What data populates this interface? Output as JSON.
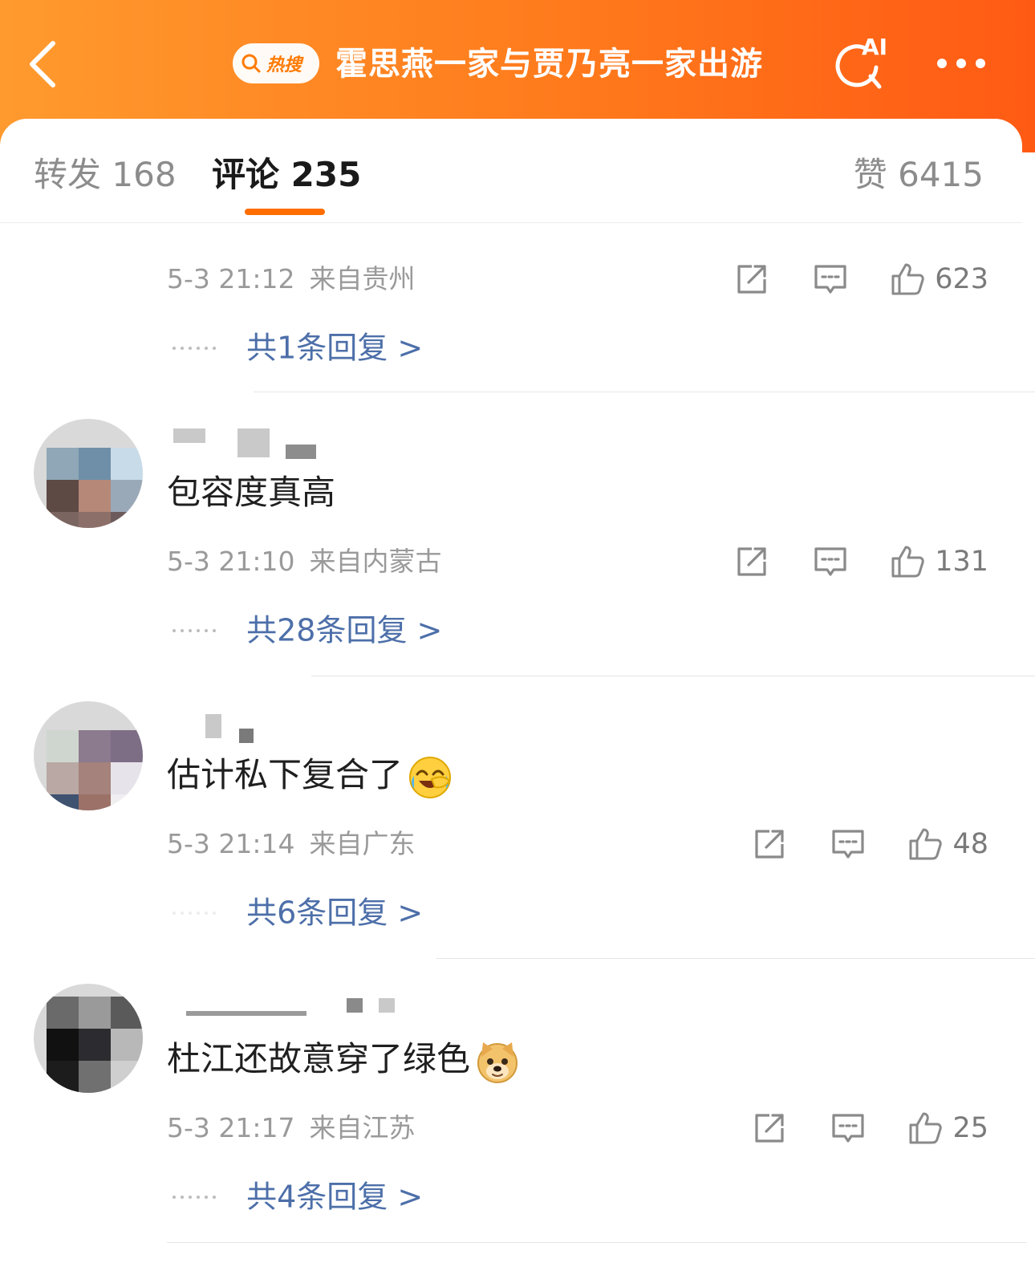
{
  "header": {
    "hot_badge": "热搜",
    "title": "霍思燕一家与贾乃亮一家出游",
    "ai_label": "AI"
  },
  "tabs": {
    "repost": {
      "label": "转发",
      "count": "168"
    },
    "comments": {
      "label": "评论",
      "count": "235"
    },
    "likes": {
      "label": "赞",
      "count": "6415"
    }
  },
  "comments": [
    {
      "text": "",
      "time": "5-3 21:12",
      "location": "来自贵州",
      "likes": "623",
      "replies": "共1条回复 >"
    },
    {
      "text": "包容度真高",
      "time": "5-3 21:10",
      "location": "来自内蒙古",
      "likes": "131",
      "replies": "共28条回复 >"
    },
    {
      "text": "估计私下复合了",
      "emoji": "laugh-cry-emoji",
      "time": "5-3 21:14",
      "location": "来自广东",
      "likes": "48",
      "replies": "共6条回复 >"
    },
    {
      "text": "杜江还故意穿了绿色",
      "emoji": "doge-emoji",
      "time": "5-3 21:17",
      "location": "来自江苏",
      "likes": "25",
      "replies": "共4条回复 >"
    }
  ],
  "colors": {
    "header_start": "#ff9a2e",
    "header_end": "#ff5a14",
    "tab_indicator": "#ff6d00",
    "reply_link": "#4d6fa9"
  }
}
